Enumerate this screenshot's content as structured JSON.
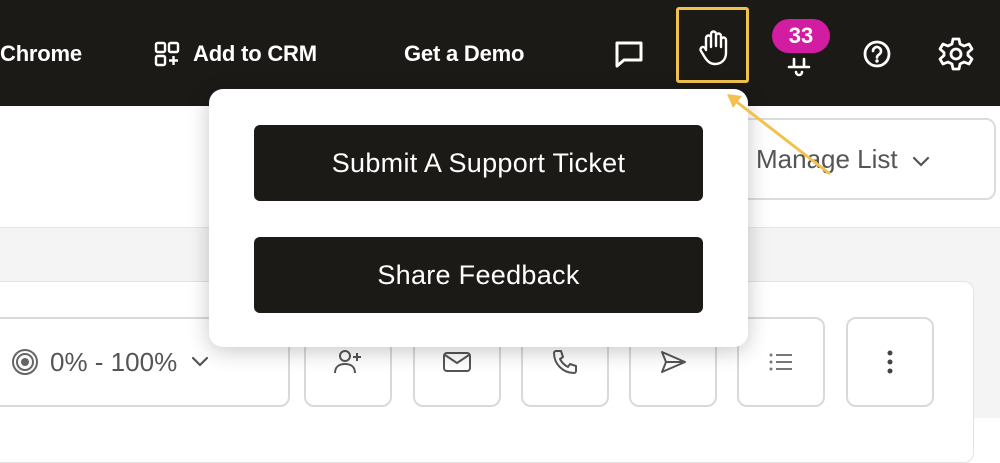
{
  "topbar": {
    "chrome_label": "Chrome",
    "add_to_crm_label": "Add to CRM",
    "get_demo_label": "Get a Demo",
    "notification_count": "33"
  },
  "popup": {
    "submit_ticket_label": "Submit A Support Ticket",
    "share_feedback_label": "Share Feedback"
  },
  "toolbar": {
    "manage_list_label": "Manage List",
    "range_label": "0% - 100%"
  },
  "colors": {
    "topbar_bg": "#1c1a17",
    "highlight": "#f2c14e",
    "badge": "#d21ca1",
    "button_bg": "#1c1a17"
  },
  "icons": [
    "chat-icon",
    "hand-icon",
    "bell-icon",
    "help-icon",
    "gear-icon",
    "chevron-down-icon",
    "target-icon",
    "add-user-icon",
    "mail-icon",
    "phone-icon",
    "send-icon",
    "list-icon",
    "more-vertical-icon"
  ]
}
